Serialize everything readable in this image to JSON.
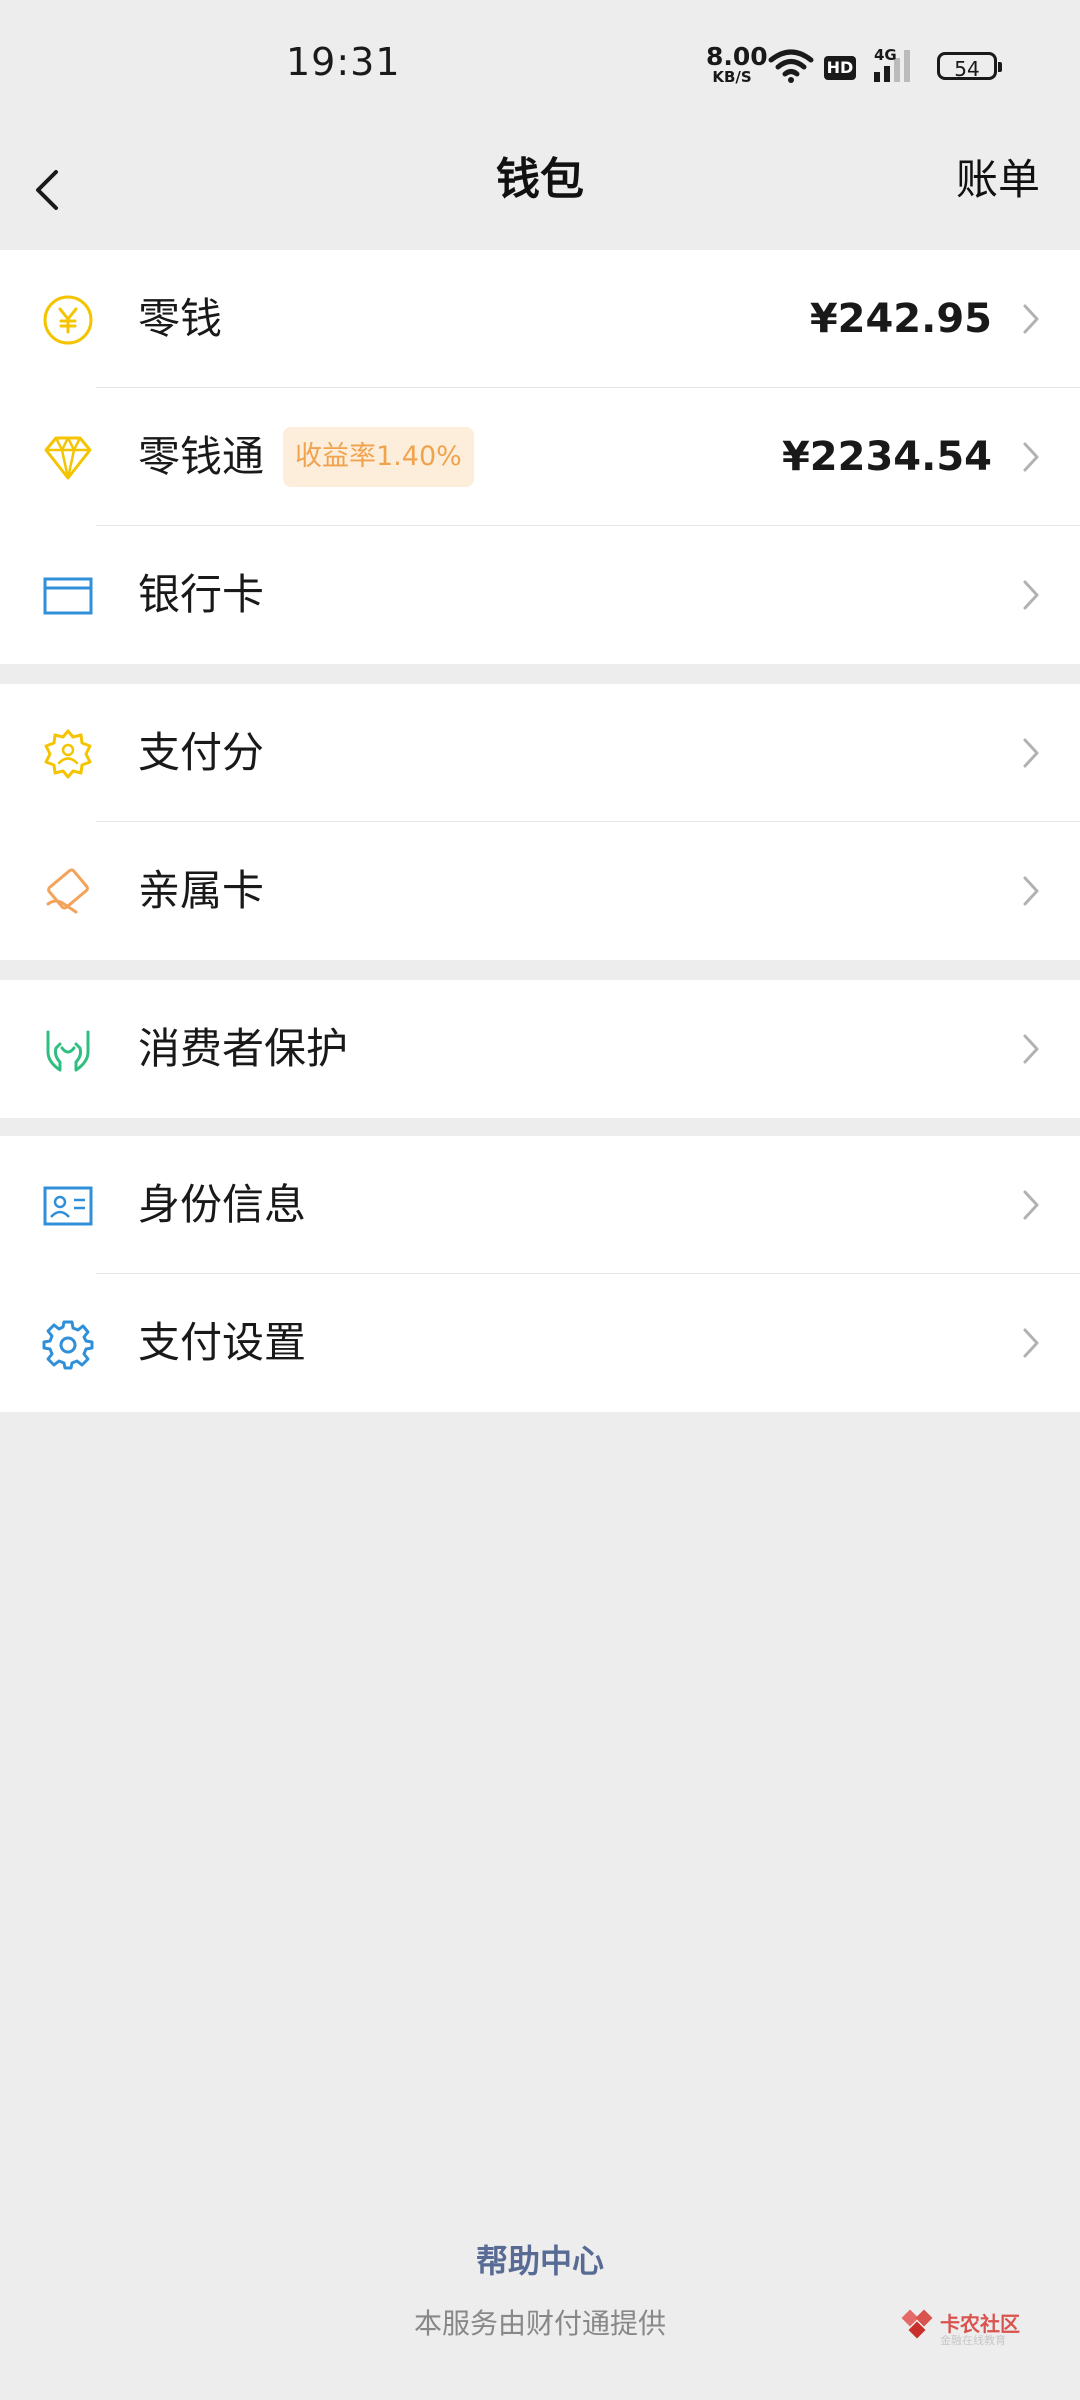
{
  "status_bar": {
    "time": "19:31",
    "net_speed": "8.00",
    "net_unit": "KB/S",
    "hd": "HD",
    "network": "4G",
    "battery": "54"
  },
  "nav": {
    "title": "钱包",
    "right_action": "账单"
  },
  "groups": [
    {
      "items": [
        {
          "label": "零钱",
          "value": "¥242.95",
          "icon": "yuan-coin-icon"
        },
        {
          "label": "零钱通",
          "badge": "收益率1.40%",
          "value": "¥2234.54",
          "icon": "diamond-icon"
        },
        {
          "label": "银行卡",
          "icon": "bank-card-icon"
        }
      ]
    },
    {
      "items": [
        {
          "label": "支付分",
          "icon": "badge-score-icon"
        },
        {
          "label": "亲属卡",
          "icon": "family-card-icon"
        }
      ]
    },
    {
      "items": [
        {
          "label": "消费者保护",
          "icon": "protect-hands-icon"
        }
      ]
    },
    {
      "items": [
        {
          "label": "身份信息",
          "icon": "id-card-icon"
        },
        {
          "label": "支付设置",
          "icon": "gear-icon"
        }
      ]
    }
  ],
  "footer": {
    "help": "帮助中心",
    "provider": "本服务由财付通提供"
  },
  "watermark": {
    "name": "卡农社区",
    "sub": "金融在线教育"
  },
  "colors": {
    "background": "#ededed",
    "link": "#576b95",
    "badge_bg": "#fdeedb",
    "badge_text": "#f0a34c",
    "yellow_icon": "#f5c400",
    "blue_icon": "#2f8fd8",
    "green_icon": "#2dbf7f",
    "orange_icon": "#f3a35a"
  }
}
